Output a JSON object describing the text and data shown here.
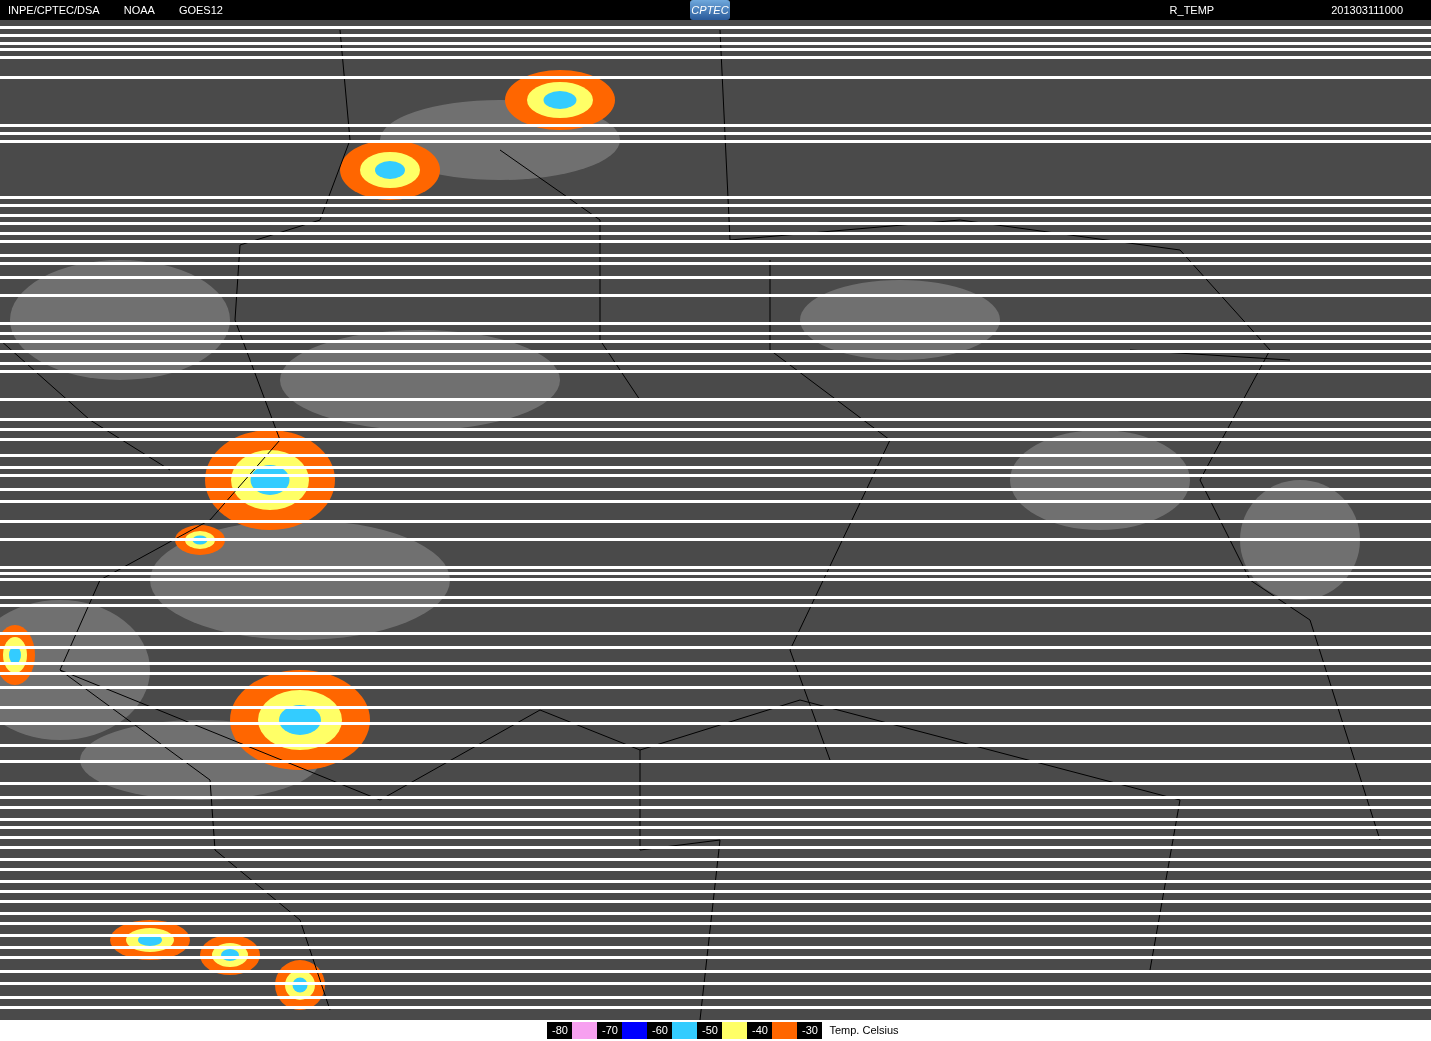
{
  "header": {
    "labels": [
      "INPE/CPTEC/DSA",
      "NOAA",
      "GOES12"
    ],
    "logo": "CPTEC",
    "product": "R_TEMP",
    "timestamp": "201303111000"
  },
  "legend": {
    "items": [
      {
        "kind": "label",
        "text": "-80"
      },
      {
        "kind": "swatch",
        "color": "#f7a0f0"
      },
      {
        "kind": "label",
        "text": "-70"
      },
      {
        "kind": "swatch",
        "color": "#0000ff"
      },
      {
        "kind": "label",
        "text": "-60"
      },
      {
        "kind": "swatch",
        "color": "#33ccff"
      },
      {
        "kind": "label",
        "text": "-50"
      },
      {
        "kind": "swatch",
        "color": "#ffff66"
      },
      {
        "kind": "label",
        "text": "-40"
      },
      {
        "kind": "swatch",
        "color": "#ff6600"
      },
      {
        "kind": "label",
        "text": "-30"
      }
    ],
    "unit": "Temp. Celsius"
  }
}
